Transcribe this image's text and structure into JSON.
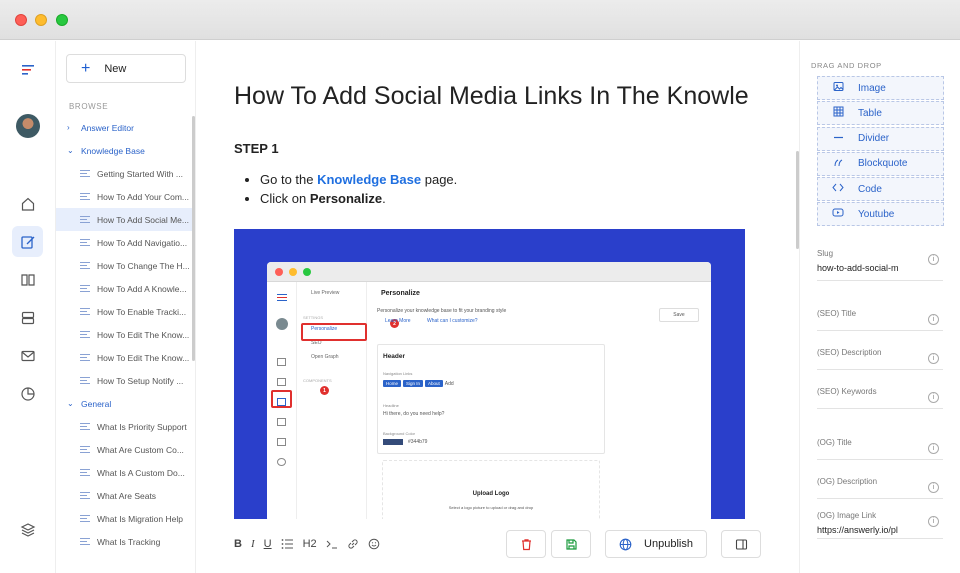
{
  "window": {
    "title": ""
  },
  "sidebar": {
    "new_label": "New",
    "browse_label": "BROWSE",
    "tree": [
      {
        "type": "folder",
        "label": "Answer Editor",
        "expanded": false
      },
      {
        "type": "folder",
        "label": "Knowledge Base",
        "expanded": true
      },
      {
        "type": "page",
        "label": "Getting Started With ..."
      },
      {
        "type": "page",
        "label": "How To Add Your Com..."
      },
      {
        "type": "page",
        "label": "How To Add Social Me...",
        "selected": true
      },
      {
        "type": "page",
        "label": "How To Add Navigatio..."
      },
      {
        "type": "page",
        "label": "How To Change The H..."
      },
      {
        "type": "page",
        "label": "How To Add A Knowle..."
      },
      {
        "type": "page",
        "label": "How To Enable Tracki..."
      },
      {
        "type": "page",
        "label": "How To Edit The Know..."
      },
      {
        "type": "page",
        "label": "How To Edit The Know..."
      },
      {
        "type": "page",
        "label": "How To Setup Notify ..."
      },
      {
        "type": "folder",
        "label": "General",
        "expanded": true
      },
      {
        "type": "page",
        "label": "What Is Priority Support"
      },
      {
        "type": "page",
        "label": "What Are Custom Co..."
      },
      {
        "type": "page",
        "label": "What Is A Custom Do..."
      },
      {
        "type": "page",
        "label": "What Are Seats"
      },
      {
        "type": "page",
        "label": "What Is Migration Help"
      },
      {
        "type": "page",
        "label": "What Is Tracking"
      }
    ]
  },
  "article": {
    "title": "How To Add Social Media Links In The Knowle",
    "step_heading": "STEP 1",
    "step_items": [
      {
        "before": "Go to the ",
        "link": "Knowledge Base",
        "after": " page."
      },
      {
        "before": "Click on ",
        "bold": "Personalize",
        "after": "."
      }
    ]
  },
  "embedded_screenshot": {
    "live_preview": "Live Preview",
    "settings_label": "SETTINGS",
    "personalize": "Personalize",
    "seo": "SEO",
    "open_graph": "Open Graph",
    "components_label": "COMPONENTS",
    "header_title": "Personalize",
    "subtitle": "Personalize your knowledge base to fit your branding style",
    "learn_more": "Learn More",
    "what_can": "What can I customize?",
    "save": "Save",
    "card_title": "Header",
    "nav_links_label": "Navigation Links",
    "chips": [
      "Home",
      "Sign In",
      "About"
    ],
    "add": "Add",
    "headline_label": "Headline",
    "headline_value": "Hi there, do you need help?",
    "bg_color_label": "Background Color",
    "bg_color_value": "#344b79",
    "upload_title": "Upload Logo",
    "upload_sub": "Select a logo picture to upload or drag and drop",
    "badge_1": "1",
    "badge_2": "2"
  },
  "toolbar": {
    "format_buttons": [
      "B",
      "I",
      "U",
      "H2"
    ],
    "unpublish_label": "Unpublish"
  },
  "right_panel": {
    "drag_drop_label": "DRAG AND DROP",
    "blocks": [
      {
        "icon": "image-icon",
        "label": "Image"
      },
      {
        "icon": "table-icon",
        "label": "Table"
      },
      {
        "icon": "divider-icon",
        "label": "Divider"
      },
      {
        "icon": "blockquote-icon",
        "label": "Blockquote"
      },
      {
        "icon": "code-icon",
        "label": "Code"
      },
      {
        "icon": "youtube-icon",
        "label": "Youtube"
      }
    ],
    "fields": [
      {
        "label": "Slug",
        "value": "how-to-add-social-m"
      },
      {
        "label": "(SEO) Title",
        "value": ""
      },
      {
        "label": "(SEO) Description",
        "value": ""
      },
      {
        "label": "(SEO) Keywords",
        "value": ""
      },
      {
        "label": "(OG) Title",
        "value": ""
      },
      {
        "label": "(OG) Description",
        "value": ""
      },
      {
        "label": "(OG) Image Link",
        "value": "https://answerly.io/pl"
      }
    ]
  },
  "colors": {
    "accent": "#2b63c9",
    "link": "#1f6fe0",
    "screenshot_bg": "#2a3fcb",
    "danger": "#e0302e",
    "success": "#1a9a3c"
  }
}
